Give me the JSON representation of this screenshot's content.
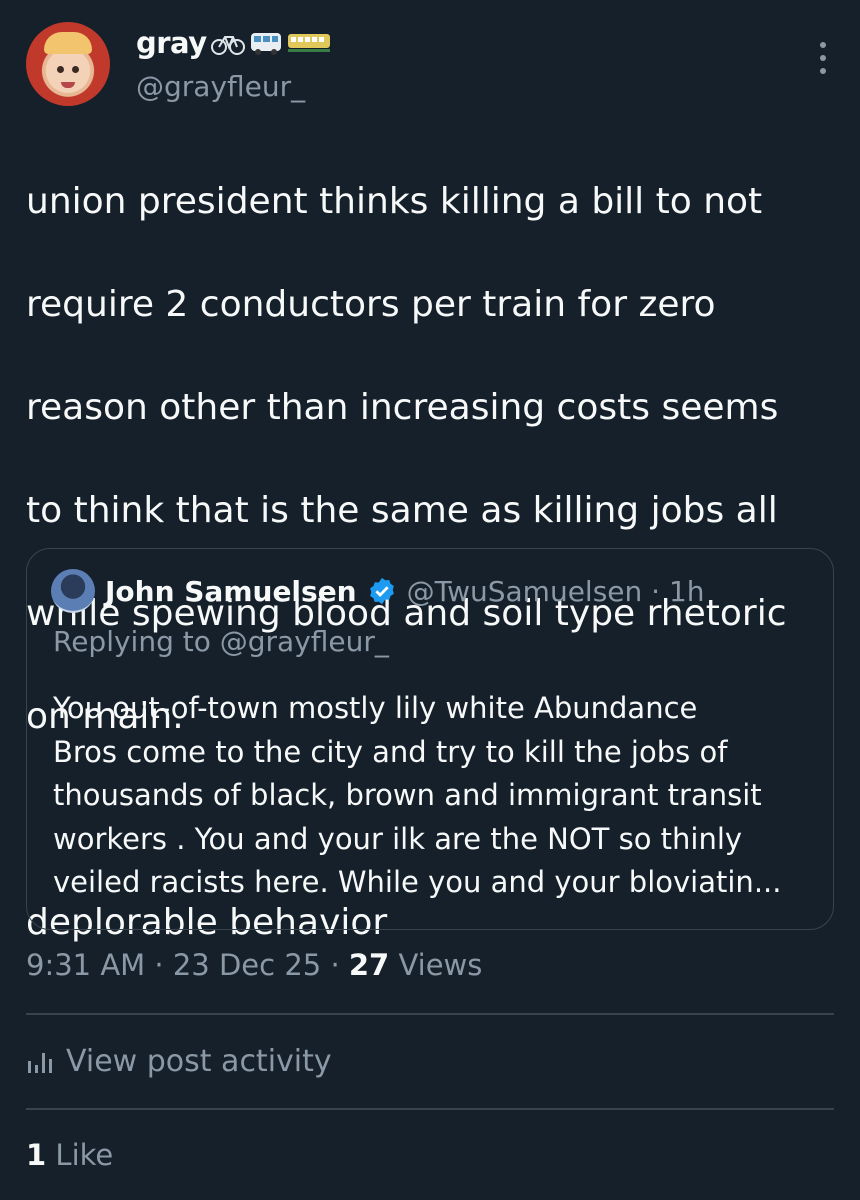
{
  "post": {
    "display_name": "gray",
    "name_emojis": [
      "bicycle",
      "bus",
      "train"
    ],
    "handle": "@grayfleur_",
    "body_lines": [
      "union president thinks killing a bill to not",
      "require 2 conductors per train for zero",
      "reason other than increasing costs seems",
      "to think that is the same as killing jobs all",
      "while spewing blood and soil type rhetoric",
      "on main.",
      "",
      "deplorable behavior"
    ]
  },
  "quote": {
    "name": "John Samuelsen",
    "handle_time": "@TwuSamuelsen · 1h",
    "replying_to": "Replying to @grayfleur_",
    "text_lines": [
      "You out-of-town mostly lily white Abundance",
      "Bros come to the city and try to kill the jobs of",
      "thousands of black,  brown and immigrant transit",
      "workers . You and your ilk are the NOT so thinly",
      "veiled racists here. While you and your bloviatin..."
    ]
  },
  "meta": {
    "time": "9:31 AM",
    "date": "23 Dec 25",
    "views_count": "27",
    "views_label": "Views",
    "sep": "·"
  },
  "activity_label": "View post activity",
  "likes": {
    "count": "1",
    "label": "Like"
  },
  "icons": {
    "more": "more-vertical-icon",
    "verified": "verified-badge-icon",
    "analytics": "analytics-icon"
  },
  "colors": {
    "background": "#15202b",
    "text": "#f7f9f9",
    "secondary": "#8b98a5",
    "border": "#38444d",
    "verified": "#1d9bf0"
  }
}
